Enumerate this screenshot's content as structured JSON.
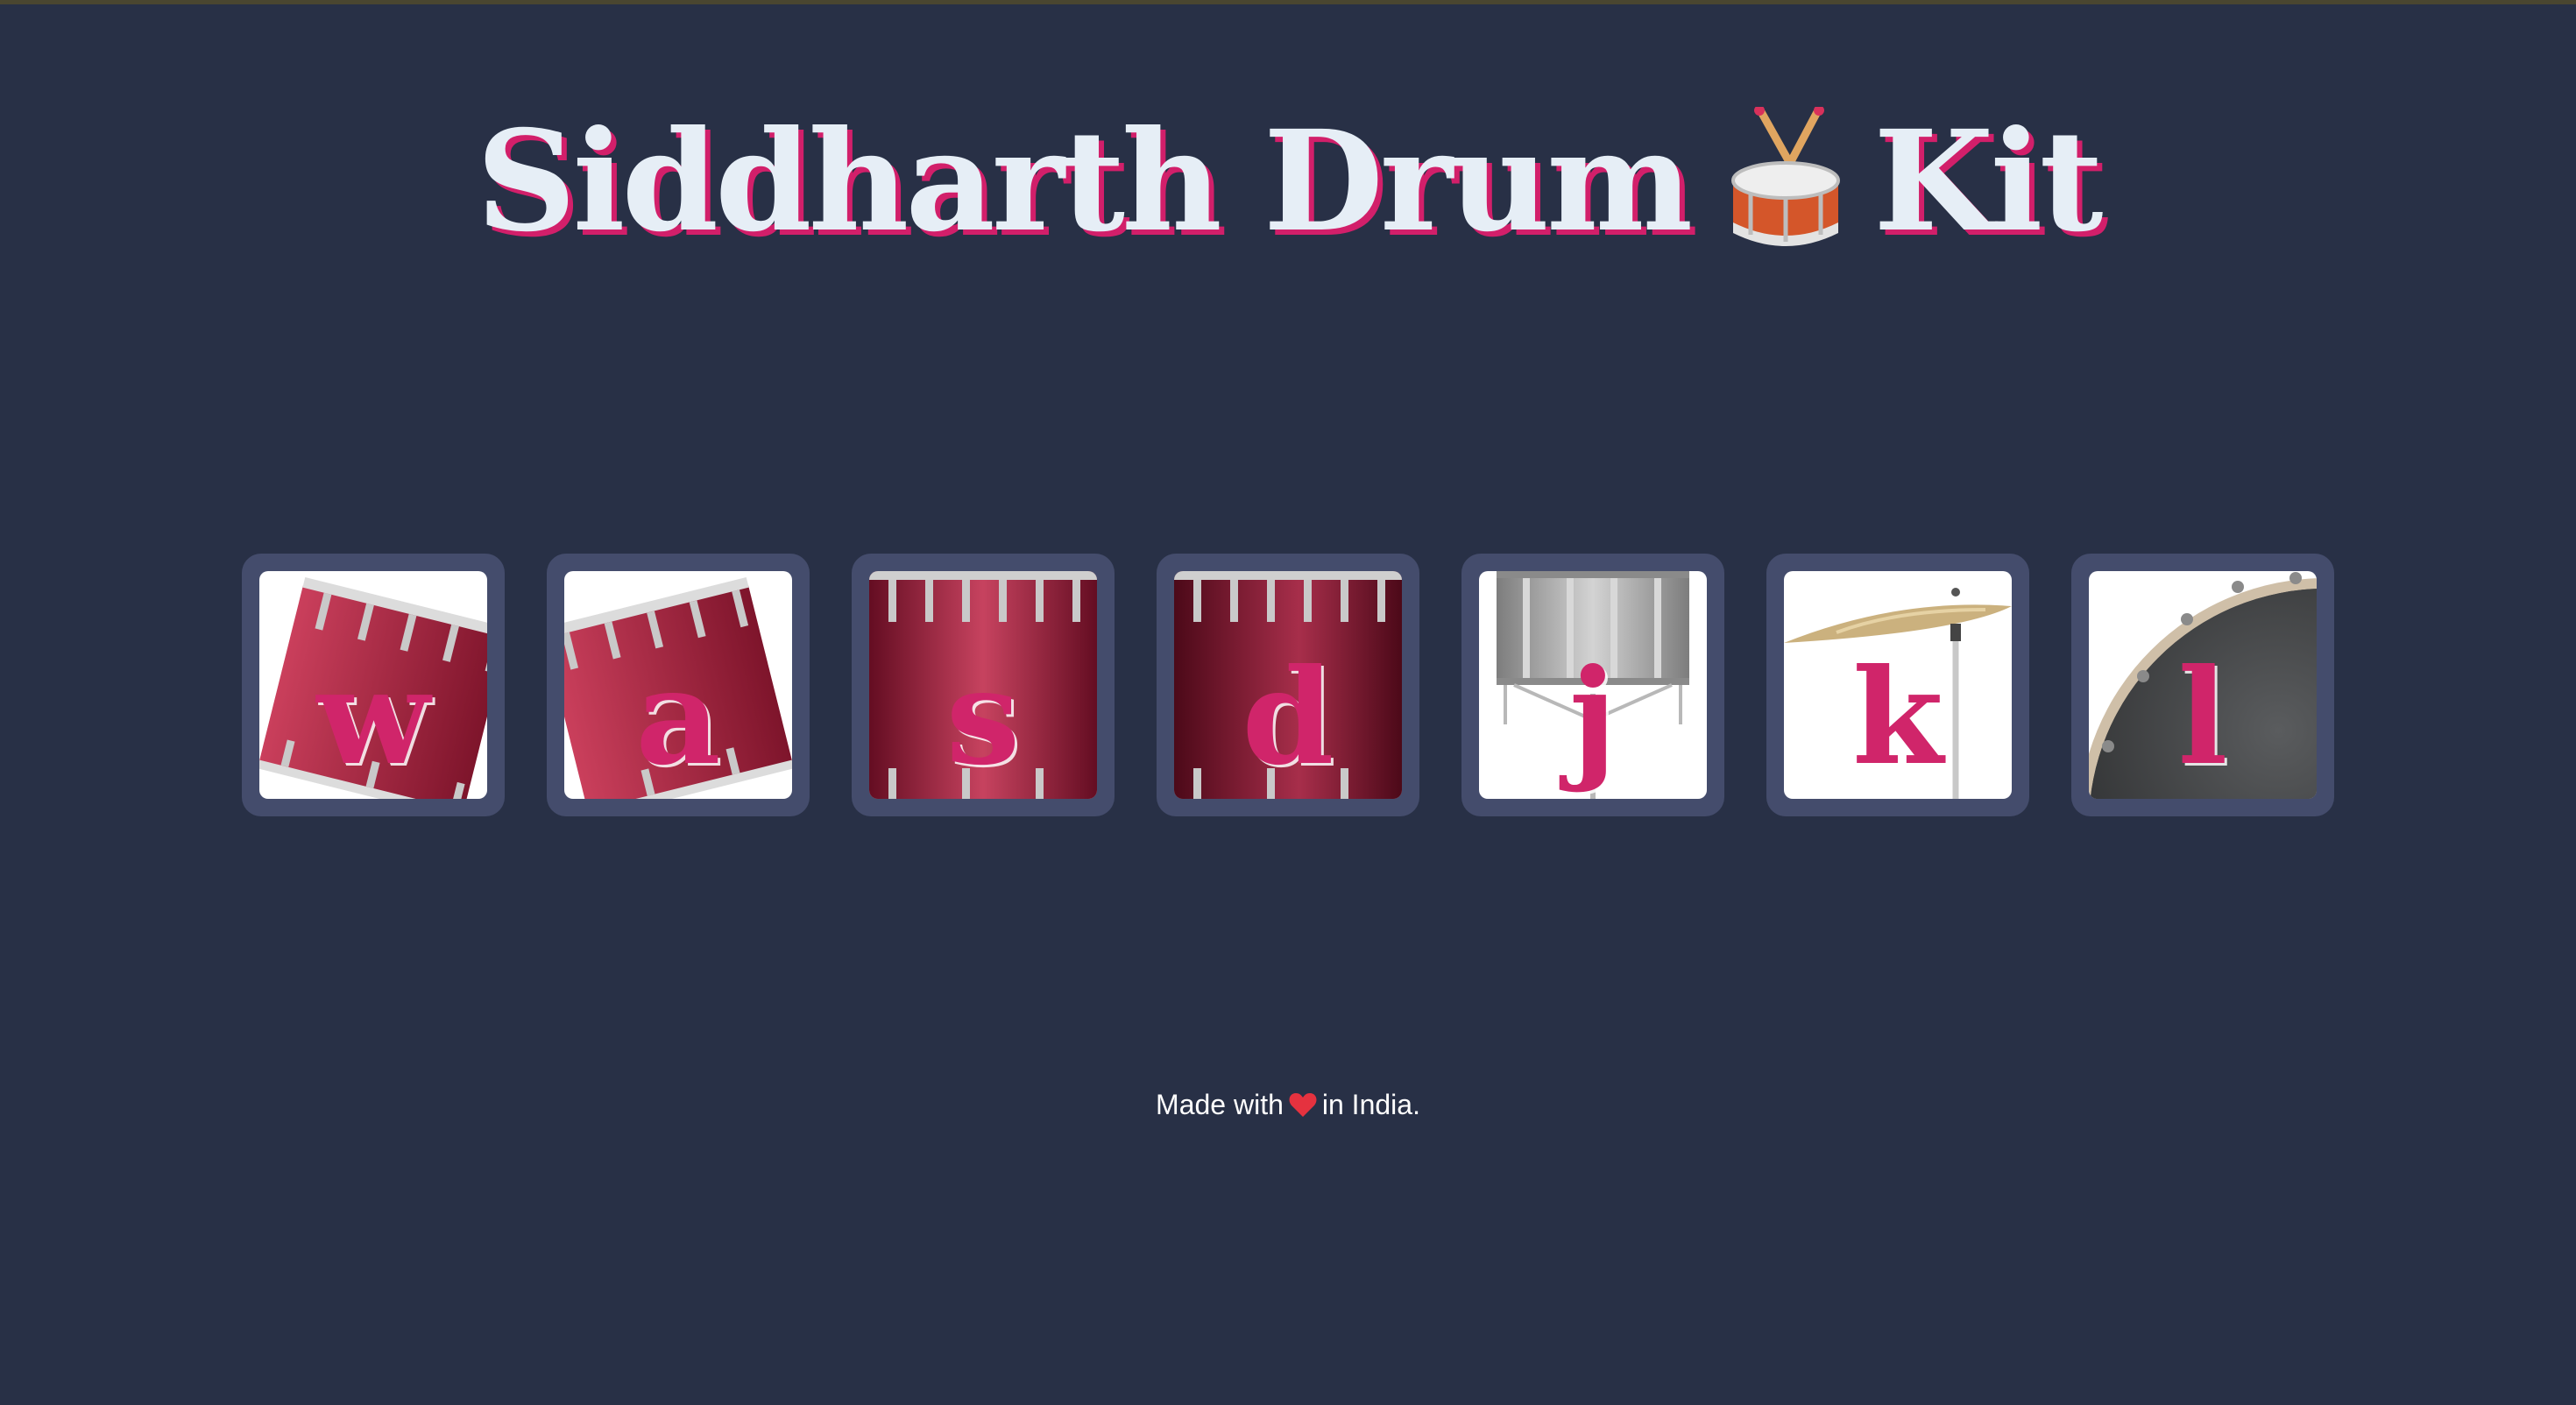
{
  "page": {
    "title_part1": "Siddharth Drum",
    "title_emoji": "drum-icon",
    "title_part2": "Kit",
    "footer_part1": "Made with",
    "footer_emoji": "heart-icon",
    "footer_part2": "in India."
  },
  "colors": {
    "background": "#283046",
    "title": "#e6eef6",
    "title_shadow": "#d21f6a",
    "key_letter": "#d0256a",
    "card": "#444c6c"
  },
  "drums": [
    {
      "key": "w",
      "image": "tom-drum-icon"
    },
    {
      "key": "a",
      "image": "tom-drum-icon"
    },
    {
      "key": "s",
      "image": "floor-tom-icon"
    },
    {
      "key": "d",
      "image": "floor-tom-icon"
    },
    {
      "key": "j",
      "image": "snare-drum-icon"
    },
    {
      "key": "k",
      "image": "cymbal-icon"
    },
    {
      "key": "l",
      "image": "bass-drum-icon"
    }
  ]
}
